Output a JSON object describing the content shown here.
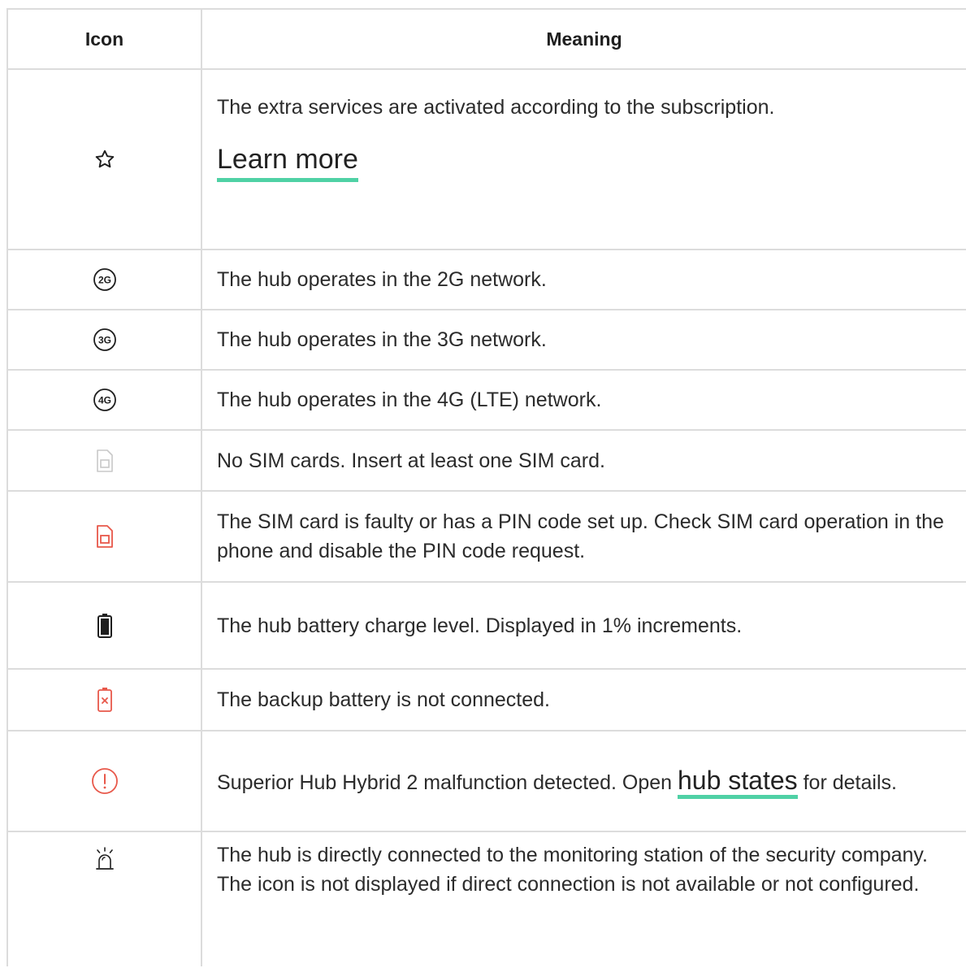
{
  "header": {
    "icon": "Icon",
    "meaning": "Meaning"
  },
  "rows": [
    {
      "icon": "star-outline-icon",
      "text": "The extra services are activated according to the subscription.",
      "link": "Learn more"
    },
    {
      "icon": "2g-network-icon",
      "icon_label": "2G",
      "text": "The hub operates in the 2G network."
    },
    {
      "icon": "3g-network-icon",
      "icon_label": "3G",
      "text": "The hub operates in the 3G network."
    },
    {
      "icon": "4g-network-icon",
      "icon_label": "4G",
      "text": "The hub operates in the 4G (LTE) network."
    },
    {
      "icon": "sim-card-absent-icon",
      "text": "No SIM cards. Insert at least one SIM card."
    },
    {
      "icon": "sim-card-error-icon",
      "text": "The SIM card is faulty or has a PIN code set up. Check SIM card operation in the phone and disable the PIN code request."
    },
    {
      "icon": "battery-full-icon",
      "text": "The hub battery charge level. Displayed in 1% increments."
    },
    {
      "icon": "battery-disconnected-icon",
      "text": "The backup battery is not connected."
    },
    {
      "icon": "malfunction-alert-icon",
      "text_before": "Superior Hub Hybrid 2 malfunction detected. Open",
      "link": "hub states",
      "text_after": "for details."
    },
    {
      "icon": "monitoring-station-siren-icon",
      "text": "The hub is directly connected to the monitoring station of the security company. The icon is not displayed if direct connection is not available or not configured."
    }
  ],
  "colors": {
    "accent_underline": "#4fd1a5",
    "error_red": "#e8584a",
    "border": "#dcdcdc",
    "muted_gray": "#c8c8c8"
  }
}
